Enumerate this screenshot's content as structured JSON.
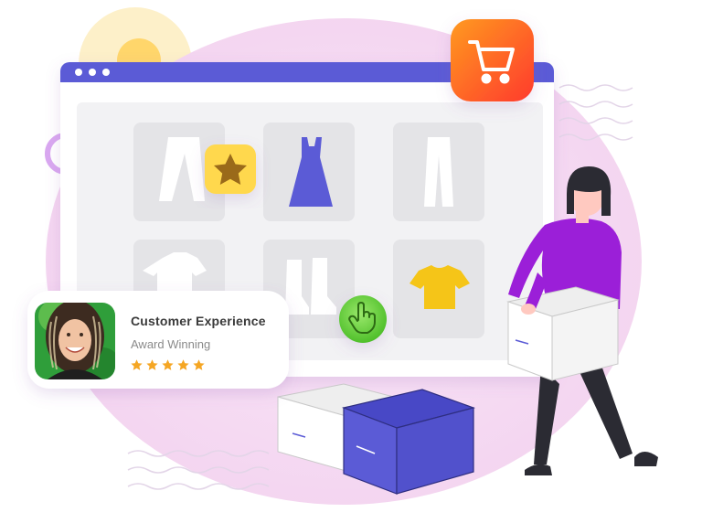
{
  "card": {
    "title": "Customer Experience",
    "subtitle": "Award Winning",
    "rating": 5,
    "rating_max": 5
  },
  "icons": {
    "cart": "shopping-cart-icon",
    "star_badge": "star-icon",
    "hand_pointer": "hand-pointer-icon"
  },
  "colors": {
    "blob": "#f6d8f2",
    "browser_bar": "#5b5bd6",
    "cart_badge_start": "#ff8a1f",
    "cart_badge_end": "#ff3d2e",
    "star_badge": "#ffd84d",
    "pointer_badge": "#7cdb4a",
    "dress": "#5b5bd6",
    "tshirt": "#f5c518",
    "person_top": "#9b1fd8",
    "box_purple": "#5b5bd6",
    "star_rating": "#f5a623"
  }
}
